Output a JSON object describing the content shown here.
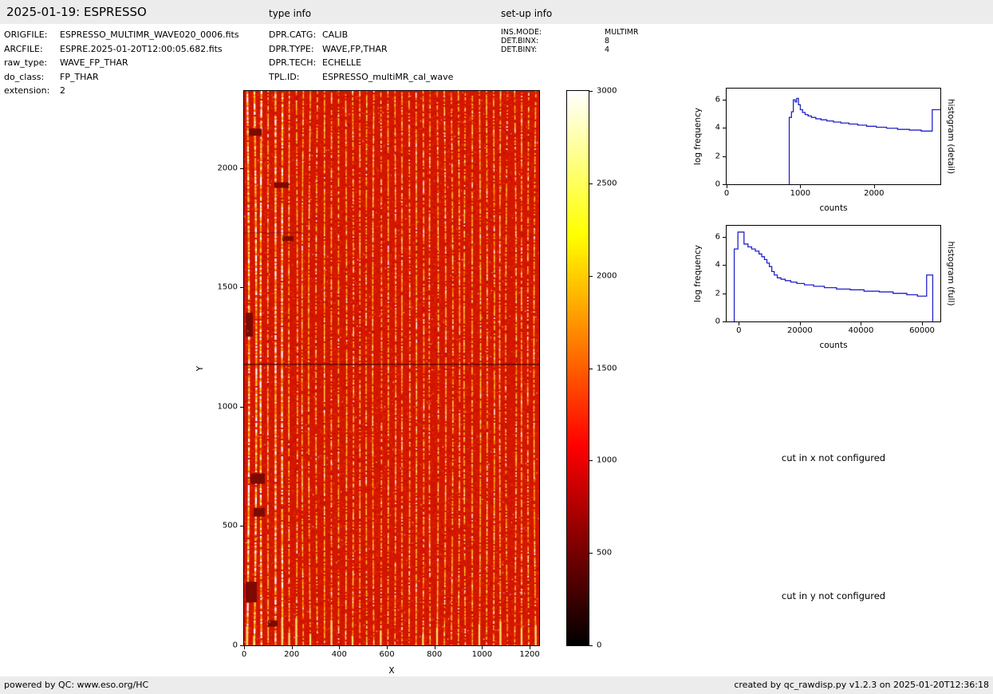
{
  "header": {
    "title": "2025-01-19: ESPRESSO",
    "type_info_label": "type info",
    "setup_info_label": "set-up info"
  },
  "file_info": {
    "rows": [
      {
        "label": "ORIGFILE:",
        "value": "ESPRESSO_MULTIMR_WAVE020_0006.fits"
      },
      {
        "label": "ARCFILE:",
        "value": "ESPRE.2025-01-20T12:00:05.682.fits"
      },
      {
        "label": "raw_type:",
        "value": "WAVE_FP_THAR"
      },
      {
        "label": "do_class:",
        "value": "FP_THAR"
      },
      {
        "label": "extension:",
        "value": "2"
      }
    ]
  },
  "type_info": {
    "rows": [
      {
        "label": "DPR.CATG:",
        "value": "CALIB"
      },
      {
        "label": "DPR.TYPE:",
        "value": "WAVE,FP,THAR"
      },
      {
        "label": "DPR.TECH:",
        "value": "ECHELLE"
      },
      {
        "label": "TPL.ID:",
        "value": "ESPRESSO_multiMR_cal_wave"
      }
    ]
  },
  "setup_info": {
    "rows": [
      {
        "label": "INS.MODE:",
        "value": "MULTIMR"
      },
      {
        "label": "DET.BINX:",
        "value": "8"
      },
      {
        "label": "DET.BINY:",
        "value": "4"
      }
    ]
  },
  "messages": {
    "cut_x": "cut in x not configured",
    "cut_y": "cut in y not configured"
  },
  "footer": {
    "left": "powered by QC: www.eso.org/HC",
    "right": "created by qc_rawdisp.py v1.2.3 on 2025-01-20T12:36:18"
  },
  "chart_data": [
    {
      "id": "raw_frame",
      "type": "heatmap",
      "xlabel": "X",
      "ylabel": "Y",
      "xlim": [
        0,
        1240
      ],
      "ylim": [
        0,
        2323
      ],
      "xticks": [
        0,
        200,
        400,
        600,
        800,
        1000,
        1200
      ],
      "yticks": [
        0,
        500,
        1000,
        1500,
        2000
      ],
      "colormap": "hot",
      "colormap_stops": [
        "#000000",
        "#ff0000",
        "#ffff00",
        "#ffffff"
      ],
      "colorbar": {
        "min": 0,
        "max": 3000,
        "ticks": [
          0,
          500,
          1000,
          1500,
          2000,
          2500,
          3000
        ]
      },
      "description": "ESPRESSO raw WAVE FP/THAR echelle frame: dotted bright yellow/white vertical spectral orders on red background, dark horizontal defect row near mid-frame, dark bad-pixel blobs at left edge"
    },
    {
      "id": "hist_detail",
      "type": "line",
      "xlabel": "counts",
      "ylabel": "log frequency",
      "right_label": "histogram (detail)",
      "xlim": [
        0,
        2900
      ],
      "ylim": [
        0,
        6.8
      ],
      "xticks": [
        0,
        1000,
        2000
      ],
      "yticks": [
        0,
        2,
        4,
        6
      ],
      "line_color": "#2222cc",
      "grid": false,
      "points": [
        [
          850,
          0
        ],
        [
          850,
          4.75
        ],
        [
          880,
          4.75
        ],
        [
          880,
          5.15
        ],
        [
          905,
          5.15
        ],
        [
          905,
          6.0
        ],
        [
          930,
          6.0
        ],
        [
          930,
          5.85
        ],
        [
          950,
          5.85
        ],
        [
          950,
          6.1
        ],
        [
          975,
          6.1
        ],
        [
          975,
          5.65
        ],
        [
          1000,
          5.65
        ],
        [
          1000,
          5.3
        ],
        [
          1030,
          5.3
        ],
        [
          1030,
          5.1
        ],
        [
          1065,
          5.1
        ],
        [
          1065,
          4.95
        ],
        [
          1105,
          4.95
        ],
        [
          1105,
          4.85
        ],
        [
          1150,
          4.85
        ],
        [
          1150,
          4.75
        ],
        [
          1210,
          4.75
        ],
        [
          1210,
          4.65
        ],
        [
          1280,
          4.65
        ],
        [
          1280,
          4.58
        ],
        [
          1360,
          4.58
        ],
        [
          1360,
          4.5
        ],
        [
          1450,
          4.5
        ],
        [
          1450,
          4.42
        ],
        [
          1550,
          4.42
        ],
        [
          1550,
          4.35
        ],
        [
          1660,
          4.35
        ],
        [
          1660,
          4.28
        ],
        [
          1780,
          4.28
        ],
        [
          1780,
          4.2
        ],
        [
          1900,
          4.2
        ],
        [
          1900,
          4.12
        ],
        [
          2030,
          4.12
        ],
        [
          2030,
          4.05
        ],
        [
          2170,
          4.05
        ],
        [
          2170,
          3.98
        ],
        [
          2320,
          3.98
        ],
        [
          2320,
          3.9
        ],
        [
          2480,
          3.9
        ],
        [
          2480,
          3.85
        ],
        [
          2640,
          3.85
        ],
        [
          2640,
          3.78
        ],
        [
          2790,
          3.78
        ],
        [
          2790,
          5.3
        ],
        [
          2900,
          5.3
        ]
      ]
    },
    {
      "id": "hist_full",
      "type": "line",
      "xlabel": "counts",
      "ylabel": "log frequency",
      "right_label": "histogram (full)",
      "xlim": [
        -4000,
        66000
      ],
      "ylim": [
        0,
        6.8
      ],
      "xticks": [
        0,
        20000,
        40000,
        60000
      ],
      "yticks": [
        0,
        2,
        4,
        6
      ],
      "line_color": "#2222cc",
      "grid": false,
      "points": [
        [
          -1500,
          0
        ],
        [
          -1500,
          5.15
        ],
        [
          -300,
          5.15
        ],
        [
          -300,
          6.35
        ],
        [
          1700,
          6.35
        ],
        [
          1700,
          5.5
        ],
        [
          3000,
          5.5
        ],
        [
          3000,
          5.3
        ],
        [
          4200,
          5.3
        ],
        [
          4200,
          5.15
        ],
        [
          5400,
          5.15
        ],
        [
          5400,
          5.0
        ],
        [
          6600,
          5.0
        ],
        [
          6600,
          4.8
        ],
        [
          7500,
          4.8
        ],
        [
          7500,
          4.6
        ],
        [
          8400,
          4.6
        ],
        [
          8400,
          4.4
        ],
        [
          9200,
          4.4
        ],
        [
          9200,
          4.15
        ],
        [
          10000,
          4.15
        ],
        [
          10000,
          3.9
        ],
        [
          10800,
          3.9
        ],
        [
          10800,
          3.55
        ],
        [
          11600,
          3.55
        ],
        [
          11600,
          3.3
        ],
        [
          12600,
          3.3
        ],
        [
          12600,
          3.1
        ],
        [
          13800,
          3.1
        ],
        [
          13800,
          3.0
        ],
        [
          15200,
          3.0
        ],
        [
          15200,
          2.9
        ],
        [
          17000,
          2.9
        ],
        [
          17000,
          2.8
        ],
        [
          19000,
          2.8
        ],
        [
          19000,
          2.7
        ],
        [
          21500,
          2.7
        ],
        [
          21500,
          2.6
        ],
        [
          24500,
          2.6
        ],
        [
          24500,
          2.5
        ],
        [
          28000,
          2.5
        ],
        [
          28000,
          2.4
        ],
        [
          32000,
          2.4
        ],
        [
          32000,
          2.3
        ],
        [
          36500,
          2.3
        ],
        [
          36500,
          2.25
        ],
        [
          41000,
          2.25
        ],
        [
          41000,
          2.15
        ],
        [
          46000,
          2.15
        ],
        [
          46000,
          2.1
        ],
        [
          50500,
          2.1
        ],
        [
          50500,
          2.0
        ],
        [
          55000,
          2.0
        ],
        [
          55000,
          1.9
        ],
        [
          58500,
          1.9
        ],
        [
          58500,
          1.8
        ],
        [
          61500,
          1.8
        ],
        [
          61500,
          3.3
        ],
        [
          63500,
          3.3
        ],
        [
          63500,
          0
        ]
      ]
    }
  ]
}
